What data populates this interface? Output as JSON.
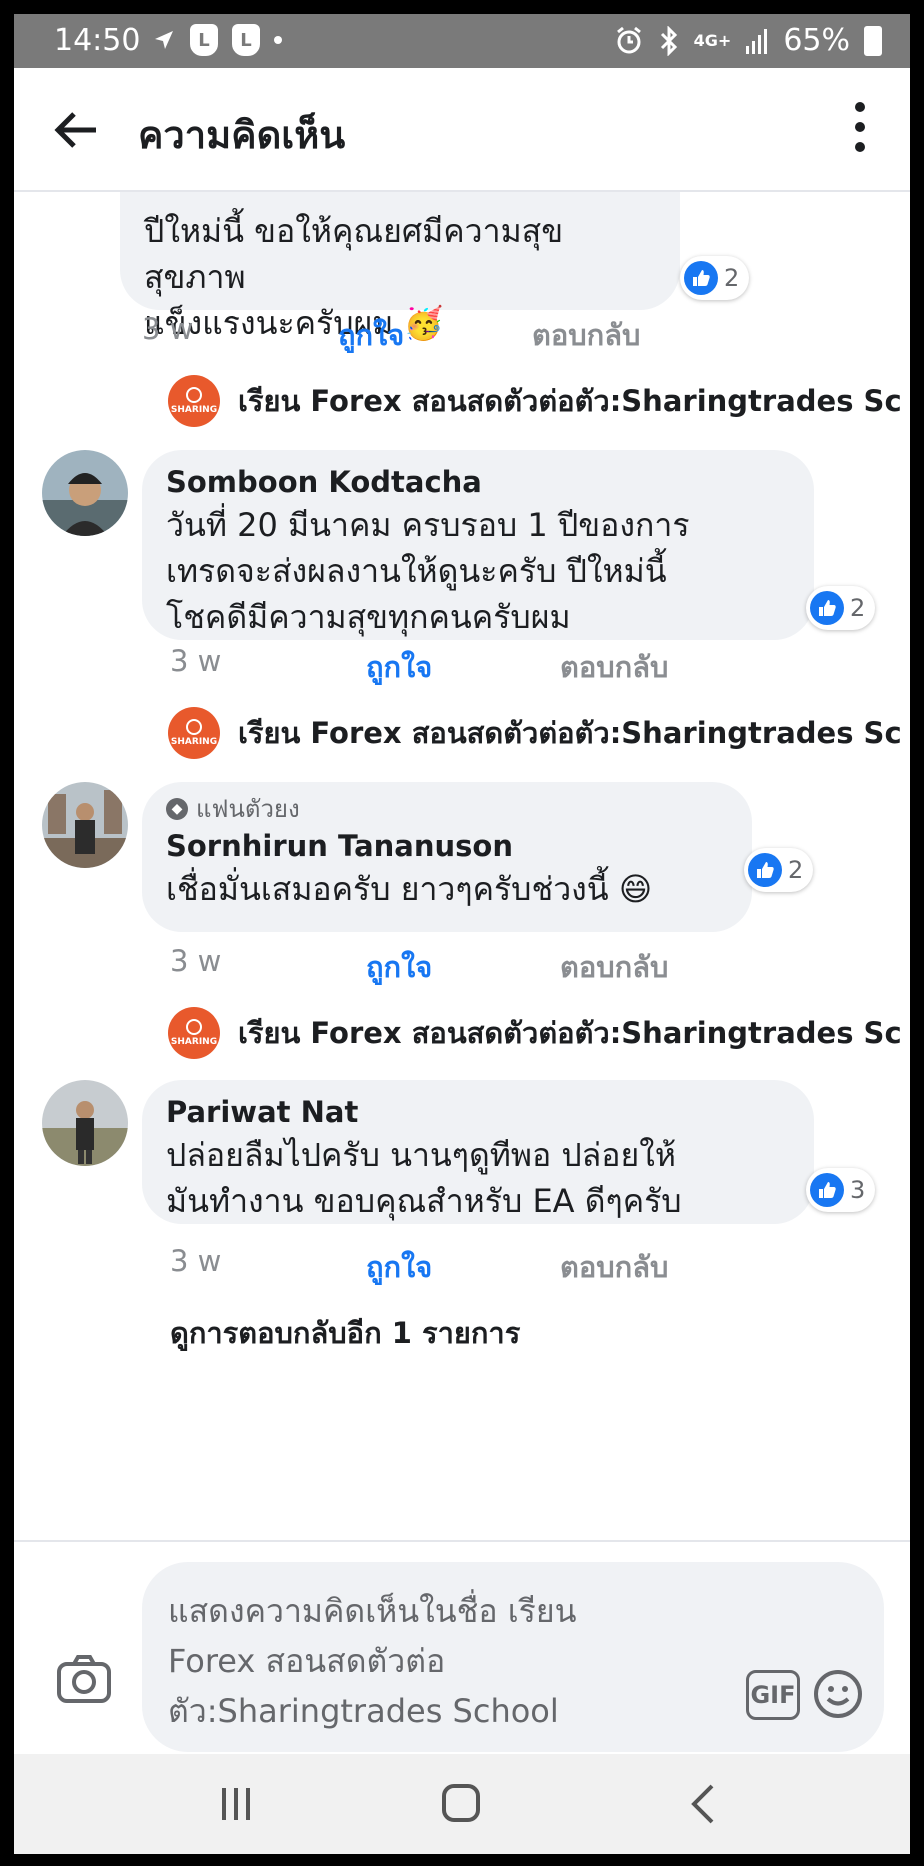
{
  "status_bar": {
    "time": "14:50",
    "badge_1": "L",
    "badge_2": "L",
    "network": "4G+",
    "battery": "65%"
  },
  "app_bar": {
    "title": "ความคิดเห็น",
    "back_icon": "arrow-left-icon",
    "more_icon": "more-vertical-icon"
  },
  "comments": [
    {
      "name": "",
      "text_line1": "ปีใหม่นี้ ขอให้คุณยศมีความสุข สุขภาพ",
      "text_line2": "แข็งแรงนะครับผม 🥳",
      "reactions": "2",
      "time": "3 w",
      "like_label": "ถูกใจ",
      "reply_label": "ตอบกลับ"
    },
    {
      "name": "Somboon Kodtacha",
      "text_line1": "วันที่ 20 มีนาคม ครบรอบ 1 ปีของการ",
      "text_line2": "เทรดจะส่งผลงานให้ดูนะครับ ปีใหม่นี้",
      "text_line3": "โชคดีมีความสุขทุกคนครับผม",
      "reactions": "2",
      "time": "3 w",
      "like_label": "ถูกใจ",
      "reply_label": "ตอบกลับ"
    },
    {
      "badge": "แฟนตัวยง",
      "name": "Sornhirun Tananuson",
      "text_line1": "เชื่อมั่นเสมอครับ ยาวๆครับช่วงนี้ 😄",
      "reactions": "2",
      "time": "3 w",
      "like_label": "ถูกใจ",
      "reply_label": "ตอบกลับ"
    },
    {
      "name": "Pariwat Nat",
      "text_line1": "ปล่อยลืมไปครับ นานๆดูทีพอ ปล่อยให้",
      "text_line2": "มันทำงาน ขอบคุณสำหรับ EA ดีๆครับ",
      "reactions": "3",
      "time": "3 w",
      "like_label": "ถูกใจ",
      "reply_label": "ตอบกลับ"
    }
  ],
  "page_reply": {
    "name": "เรียน Forex สอนสดตัวต่อตัว:Sharingtrades Sc",
    "logo_text": "SHARING"
  },
  "view_more_replies": "ดูการตอบกลับอีก 1 รายการ",
  "composer": {
    "placeholder_line1": "แสดงความคิดเห็นในชื่อ เรียน",
    "placeholder_line2": "Forex สอนสดตัวต่อ",
    "placeholder_line3": "ตัว:Sharingtrades School",
    "gif_label": "GIF"
  },
  "colors": {
    "accent": "#1877f2",
    "bubble": "#f0f2f5",
    "page_logo": "#e8592c"
  }
}
